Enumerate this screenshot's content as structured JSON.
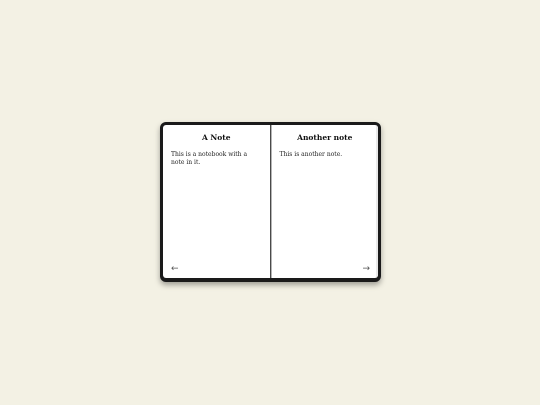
{
  "notebook": {
    "left_page": {
      "title": "A Note",
      "body": "This is a notebook with a note in it."
    },
    "right_page": {
      "title": "Another note",
      "body": "This is another note."
    },
    "nav": {
      "prev_icon": "←",
      "next_icon": "→",
      "prev_icon_name": "arrow-left-icon",
      "next_icon_name": "arrow-right-icon"
    }
  },
  "colors": {
    "background": "#f3f1e4",
    "notebook_frame": "#1a1a1a",
    "page": "#ffffff"
  }
}
